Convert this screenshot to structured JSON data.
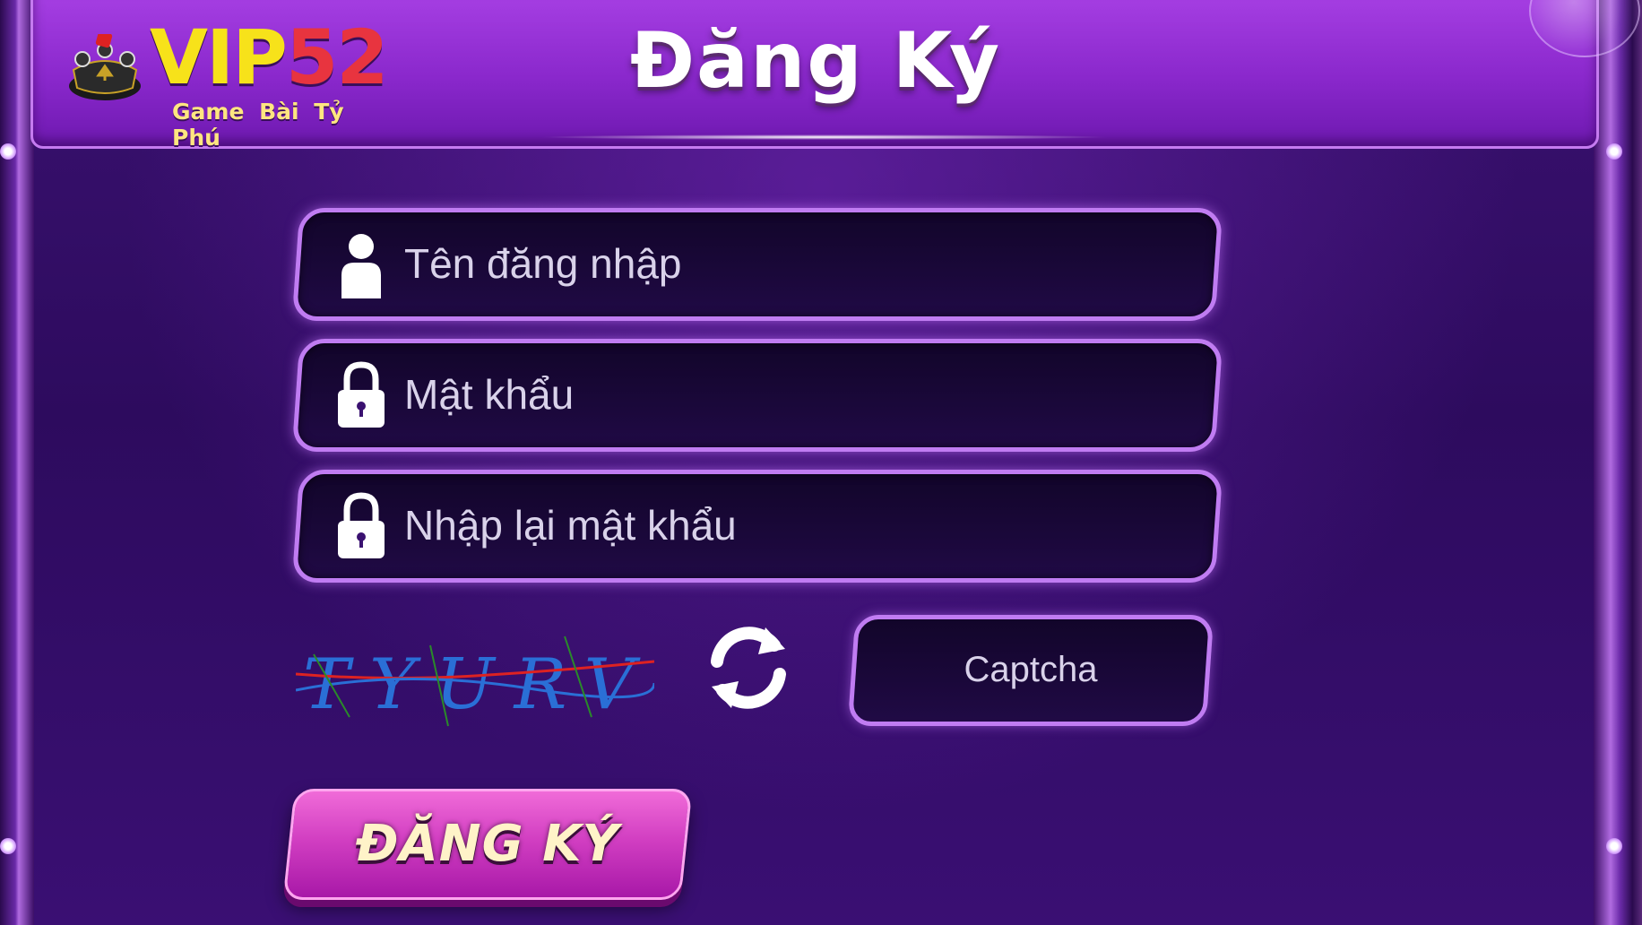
{
  "header": {
    "title": "Đăng Ký",
    "logo": {
      "brand": "VIP",
      "number": "52",
      "tagline": "Game Bài Tỷ Phú"
    }
  },
  "form": {
    "username_placeholder": "Tên đăng nhập",
    "password_placeholder": "Mật khẩu",
    "confirm_password_placeholder": "Nhập lại mật khẩu",
    "captcha_text": "TYURV",
    "captcha_placeholder": "Captcha",
    "submit_label": "ĐĂNG KÝ"
  },
  "icons": {
    "username": "user-icon",
    "password": "lock-icon",
    "confirm_password": "lock-icon",
    "refresh": "refresh-icon"
  },
  "colors": {
    "accent": "#c07cf2",
    "button": "#d23fc2",
    "title_bar": "#8a28cc"
  }
}
